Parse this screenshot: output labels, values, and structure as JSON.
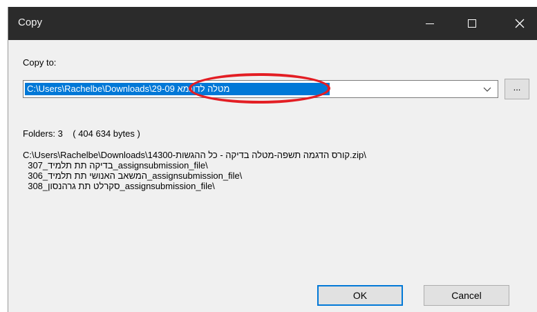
{
  "window": {
    "title": "Copy"
  },
  "copy_to": {
    "label": "Copy to:",
    "path_value": "C:\\Users\\Rachelbe\\Downloads\\29-09 מטלה לדוגמא",
    "browse_label": "..."
  },
  "summary": {
    "folders_text": "Folders: 3    ( 404 634 bytes )"
  },
  "paths": [
    "C:\\Users\\Rachelbe\\Downloads\\14300-קורס הדגמה תשפה-מטלה בדיקה - כל ההגשות.zip\\",
    "  307_בדיקה תת תלמיד_assignsubmission_file\\",
    "  306_המשאב האנושי תת תלמיד_assignsubmission_file\\",
    "  308_סקרלט תת גרהנסון_assignsubmission_file\\"
  ],
  "buttons": {
    "ok": "OK",
    "cancel": "Cancel"
  },
  "colors": {
    "titlebar": "#2b2b2b",
    "selection": "#0078d7",
    "annotation": "#e31e24"
  }
}
